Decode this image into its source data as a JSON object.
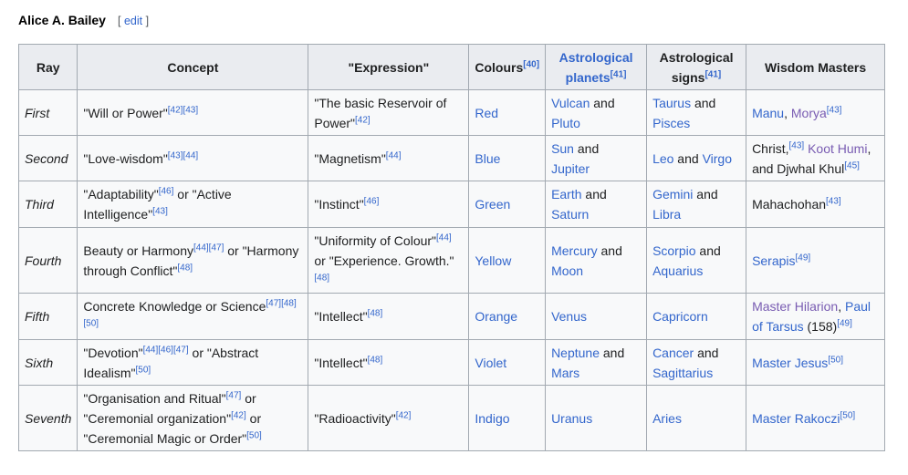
{
  "section": {
    "title": "Alice A. Bailey",
    "edit_open": "[ ",
    "edit_label": "edit",
    "edit_close": " ]"
  },
  "table": {
    "headers": {
      "ray": "Ray",
      "concept": "Concept",
      "expression": "\"Expression\"",
      "colours": "Colours",
      "colours_ref": "[40]",
      "planets": "Astrological planets",
      "planets_ref": "[41]",
      "signs": "Astrological signs",
      "signs_ref": "[41]",
      "masters": "Wisdom Masters"
    },
    "rows": [
      {
        "ray": "First",
        "concept": [
          {
            "t": "\"Will or Power\""
          },
          {
            "ref": "[42]"
          },
          {
            "ref": "[43]"
          }
        ],
        "expression": [
          {
            "t": "\"The basic Reservoir of Power\""
          },
          {
            "ref": "[42]"
          }
        ],
        "colour": [
          {
            "link": "Red"
          }
        ],
        "planets": [
          {
            "link": "Vulcan"
          },
          {
            "t": " and "
          },
          {
            "link": "Pluto"
          }
        ],
        "signs": [
          {
            "link": "Taurus"
          },
          {
            "t": " and "
          },
          {
            "link": "Pisces"
          }
        ],
        "masters": [
          {
            "link": "Manu"
          },
          {
            "t": ", "
          },
          {
            "visited": "Morya"
          },
          {
            "ref": "[43]"
          }
        ]
      },
      {
        "ray": "Second",
        "concept": [
          {
            "t": "\"Love-wisdom\""
          },
          {
            "ref": "[43]"
          },
          {
            "ref": "[44]"
          }
        ],
        "expression": [
          {
            "t": "\"Magnetism\""
          },
          {
            "ref": "[44]"
          }
        ],
        "colour": [
          {
            "link": "Blue"
          }
        ],
        "planets": [
          {
            "link": "Sun"
          },
          {
            "t": " and "
          },
          {
            "link": "Jupiter"
          }
        ],
        "signs": [
          {
            "link": "Leo"
          },
          {
            "t": " and "
          },
          {
            "link": "Virgo"
          }
        ],
        "masters": [
          {
            "t": "Christ,"
          },
          {
            "ref": "[43]"
          },
          {
            "t": " "
          },
          {
            "visited": "Koot Humi"
          },
          {
            "t": ", and Djwhal Khul"
          },
          {
            "ref": "[45]"
          }
        ]
      },
      {
        "ray": "Third",
        "concept": [
          {
            "t": "\"Adaptability\""
          },
          {
            "ref": "[46]"
          },
          {
            "t": " or \"Active Intelligence\""
          },
          {
            "ref": "[43]"
          }
        ],
        "expression": [
          {
            "t": "\"Instinct\""
          },
          {
            "ref": "[46]"
          }
        ],
        "colour": [
          {
            "link": "Green"
          }
        ],
        "planets": [
          {
            "link": "Earth"
          },
          {
            "t": " and "
          },
          {
            "link": "Saturn"
          }
        ],
        "signs": [
          {
            "link": "Gemini"
          },
          {
            "t": " and "
          },
          {
            "link": "Libra"
          }
        ],
        "masters": [
          {
            "t": "Mahachohan"
          },
          {
            "ref": "[43]"
          }
        ]
      },
      {
        "ray": "Fourth",
        "concept": [
          {
            "t": "Beauty or Harmony"
          },
          {
            "ref": "[44]"
          },
          {
            "ref": "[47]"
          },
          {
            "t": " or \"Harmony through Conflict\""
          },
          {
            "ref": "[48]"
          }
        ],
        "expression": [
          {
            "t": "\"Uniformity of Colour\""
          },
          {
            "ref": "[44]"
          },
          {
            "t": " or \"Experience. Growth.\""
          },
          {
            "ref": "[48]"
          }
        ],
        "colour": [
          {
            "link": "Yellow"
          }
        ],
        "planets": [
          {
            "link": "Mercury"
          },
          {
            "t": " and "
          },
          {
            "link": "Moon"
          }
        ],
        "signs": [
          {
            "link": "Scorpio"
          },
          {
            "t": " and "
          },
          {
            "link": "Aquarius"
          }
        ],
        "masters": [
          {
            "link": "Serapis"
          },
          {
            "ref": "[49]"
          }
        ]
      },
      {
        "ray": "Fifth",
        "concept": [
          {
            "t": "Concrete Knowledge or Science"
          },
          {
            "ref": "[47]"
          },
          {
            "ref": "[48]"
          },
          {
            "ref": "[50]"
          }
        ],
        "expression": [
          {
            "t": "\"Intellect\""
          },
          {
            "ref": "[48]"
          }
        ],
        "colour": [
          {
            "link": "Orange"
          }
        ],
        "planets": [
          {
            "link": "Venus"
          }
        ],
        "signs": [
          {
            "link": "Capricorn"
          }
        ],
        "masters": [
          {
            "visited": "Master Hilarion"
          },
          {
            "t": ", "
          },
          {
            "link": "Paul of Tarsus"
          },
          {
            "t": " (158)"
          },
          {
            "ref": "[49]"
          }
        ]
      },
      {
        "ray": "Sixth",
        "concept": [
          {
            "t": "\"Devotion\""
          },
          {
            "ref": "[44]"
          },
          {
            "ref": "[46]"
          },
          {
            "ref": "[47]"
          },
          {
            "t": " or \"Abstract Idealism\""
          },
          {
            "ref": "[50]"
          }
        ],
        "expression": [
          {
            "t": "\"Intellect\""
          },
          {
            "ref": "[48]"
          }
        ],
        "colour": [
          {
            "link": "Violet"
          }
        ],
        "planets": [
          {
            "link": "Neptune"
          },
          {
            "t": " and "
          },
          {
            "link": "Mars"
          }
        ],
        "signs": [
          {
            "link": "Cancer"
          },
          {
            "t": " and "
          },
          {
            "link": "Sagittarius"
          }
        ],
        "masters": [
          {
            "link": "Master Jesus"
          },
          {
            "ref": "[50]"
          }
        ]
      },
      {
        "ray": "Seventh",
        "concept": [
          {
            "t": "\"Organisation and Ritual\""
          },
          {
            "ref": "[47]"
          },
          {
            "t": " or \"Ceremonial organization\""
          },
          {
            "ref": "[42]"
          },
          {
            "t": " or \"Ceremonial Magic or Order\""
          },
          {
            "ref": "[50]"
          }
        ],
        "expression": [
          {
            "t": "\"Radioactivity\""
          },
          {
            "ref": "[42]"
          }
        ],
        "colour": [
          {
            "link": "Indigo"
          }
        ],
        "planets": [
          {
            "link": "Uranus"
          }
        ],
        "signs": [
          {
            "link": "Aries"
          }
        ],
        "masters": [
          {
            "link": "Master Rakoczi"
          },
          {
            "ref": "[50]"
          }
        ]
      }
    ]
  }
}
